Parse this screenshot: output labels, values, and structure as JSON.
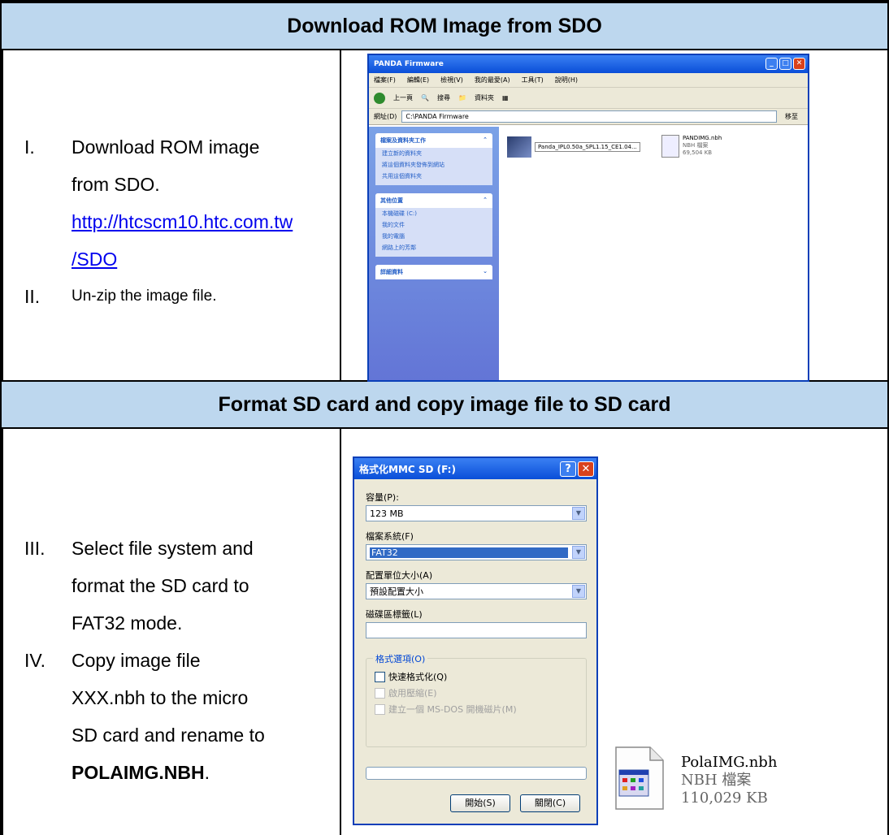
{
  "section1": {
    "header": "Download ROM Image from SDO",
    "steps": [
      {
        "num": "I.",
        "text_line1": "Download ROM image",
        "text_line2": "from SDO.",
        "link_line1": "http://htcscm10.htc.com.tw",
        "link_line2": "/SDO"
      },
      {
        "num": "II.",
        "text": "Un-zip the image file."
      }
    ],
    "explorer": {
      "title": "PANDA Firmware",
      "menu": [
        "檔案(F)",
        "編輯(E)",
        "檢視(V)",
        "我的最愛(A)",
        "工具(T)",
        "說明(H)"
      ],
      "toolbar": [
        "上一頁",
        "搜尋",
        "資料夾"
      ],
      "address_label": "網址(D)",
      "address": "C:\\PANDA Firmware",
      "go_label": "移至",
      "panels": [
        {
          "title": "檔案及資料夾工作",
          "items": [
            "建立新的資料夾",
            "將這個資料夾發佈到網站",
            "共用這個資料夾"
          ]
        },
        {
          "title": "其他位置",
          "items": [
            "本機磁碟 (C:)",
            "我的文件",
            "我的電腦",
            "網路上的芳鄰"
          ]
        },
        {
          "title": "詳細資料",
          "items": []
        }
      ],
      "file1": "Panda_IPL0.50a_SPL1.15_CE1.04...",
      "file2_name": "PANDIMG.nbh",
      "file2_type": "NBH 檔案",
      "file2_size": "69,504 KB"
    }
  },
  "section2": {
    "header": "Format SD card and copy image file to SD card",
    "steps": [
      {
        "num": "III.",
        "lines": [
          "Select file system and",
          "format the SD card to",
          "FAT32 mode."
        ]
      },
      {
        "num": "IV.",
        "lines": [
          "Copy image file",
          "XXX.nbh to the micro",
          "SD card and rename to"
        ],
        "bold_name": "POLAIMG.NBH",
        "suffix": "."
      }
    ],
    "dialog": {
      "title": "格式化MMC  SD (F:)",
      "capacity_label": "容量(P):",
      "capacity_value": "123 MB",
      "fs_label": "檔案系統(F)",
      "fs_value": "FAT32",
      "alloc_label": "配置單位大小(A)",
      "alloc_value": "預設配置大小",
      "vol_label": "磁碟區標籤(L)",
      "vol_value": "",
      "options_title": "格式選項(O)",
      "opt_quick": "快速格式化(Q)",
      "opt_compress": "啟用壓縮(E)",
      "opt_boot": "建立一個 MS-DOS 開機磁片(M)",
      "start_button": "開始(S)",
      "close_button": "關閉(C)"
    },
    "file_icon": {
      "name": "PolaIMG.nbh",
      "type": "NBH 檔案",
      "size": "110,029 KB"
    }
  }
}
